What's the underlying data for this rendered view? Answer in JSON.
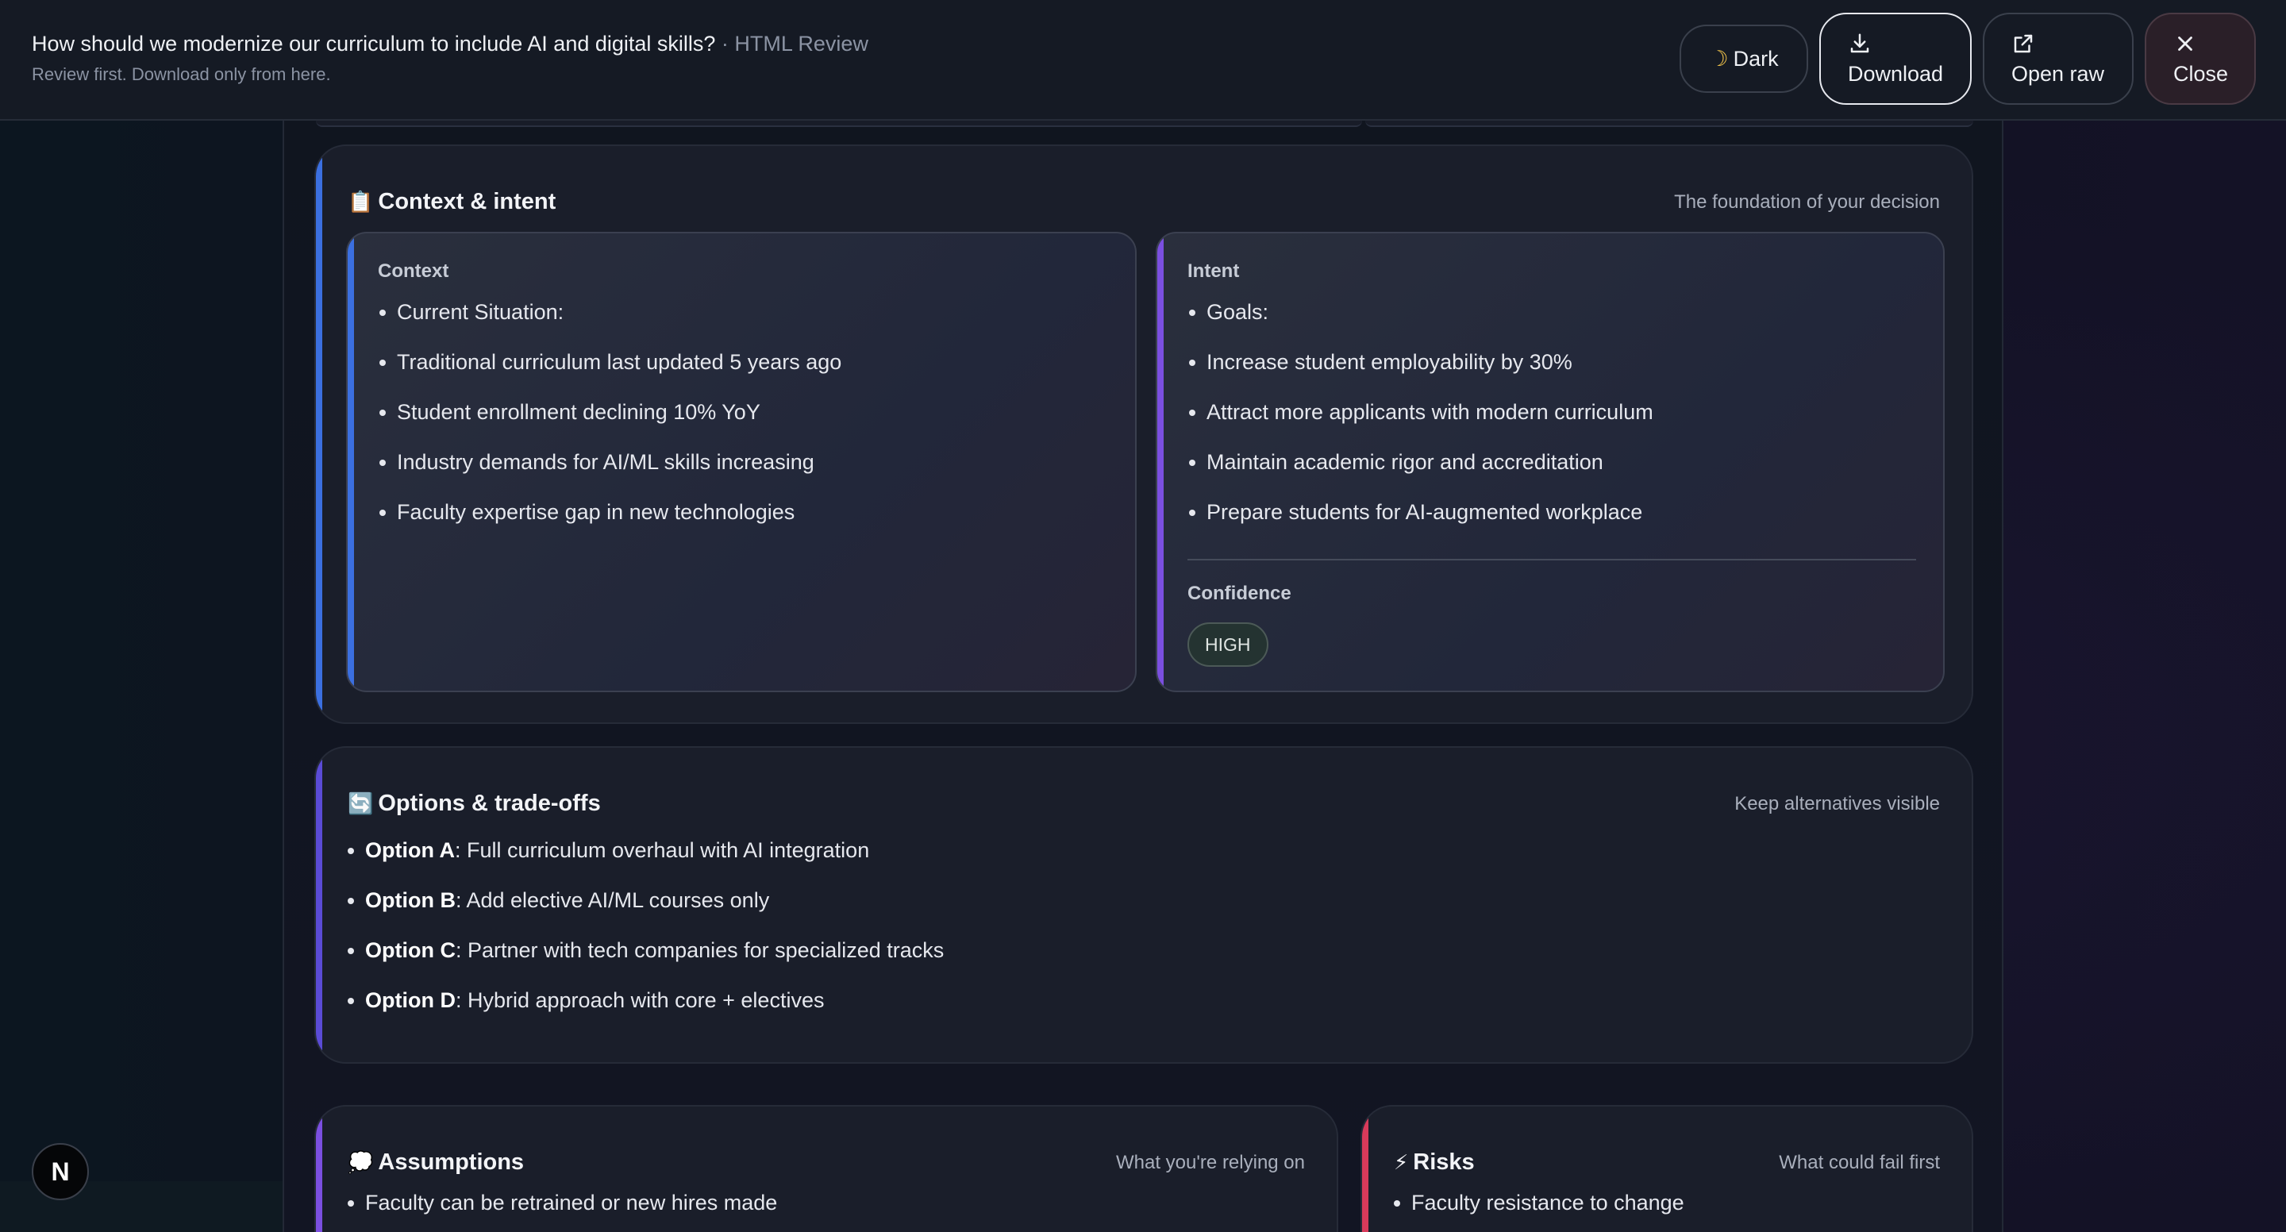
{
  "header": {
    "title": "How should we modernize our curriculum to include AI and digital skills?",
    "title_suffix": " · HTML Review",
    "subtitle": "Review first. Download only from here.",
    "buttons": {
      "theme_label": "Dark",
      "download_label": "Download",
      "open_raw_label": "Open raw",
      "close_label": "Close"
    }
  },
  "context_intent": {
    "emoji": "📋",
    "title": "Context & intent",
    "hint": "The foundation of your decision",
    "accent": "#3b6fe0",
    "context": {
      "label": "Context",
      "items": [
        "Current Situation:",
        "Traditional curriculum last updated 5 years ago",
        "Student enrollment declining 10% YoY",
        "Industry demands for AI/ML skills increasing",
        "Faculty expertise gap in new technologies"
      ]
    },
    "intent": {
      "label": "Intent",
      "accent": "#7b4fe0",
      "items": [
        "Goals:",
        "Increase student employability by 30%",
        "Attract more applicants with modern curriculum",
        "Maintain academic rigor and accreditation",
        "Prepare students for AI-augmented workplace"
      ],
      "confidence_label": "Confidence",
      "confidence_value": "HIGH"
    }
  },
  "options": {
    "emoji": "🔄",
    "title": "Options & trade-offs",
    "hint": "Keep alternatives visible",
    "accent": "#5a4bd6",
    "items": [
      {
        "key": "Option A",
        "text": ": Full curriculum overhaul with AI integration"
      },
      {
        "key": "Option B",
        "text": ": Add elective AI/ML courses only"
      },
      {
        "key": "Option C",
        "text": ": Partner with tech companies for specialized tracks"
      },
      {
        "key": "Option D",
        "text": ": Hybrid approach with core + electives"
      }
    ]
  },
  "assumptions": {
    "emoji": "💭",
    "title": "Assumptions",
    "hint": "What you're relying on",
    "accent": "#7b4fe0",
    "items": [
      "Faculty can be retrained or new hires made"
    ]
  },
  "risks": {
    "emoji": "⚡",
    "title": "Risks",
    "hint": "What could fail first",
    "accent": "#d83a5a",
    "items": [
      "Faculty resistance to change"
    ]
  },
  "fab_label": "N",
  "icons": {
    "theme": "moon-icon",
    "download": "download-icon",
    "open_raw": "external-link-icon",
    "close": "close-icon"
  }
}
